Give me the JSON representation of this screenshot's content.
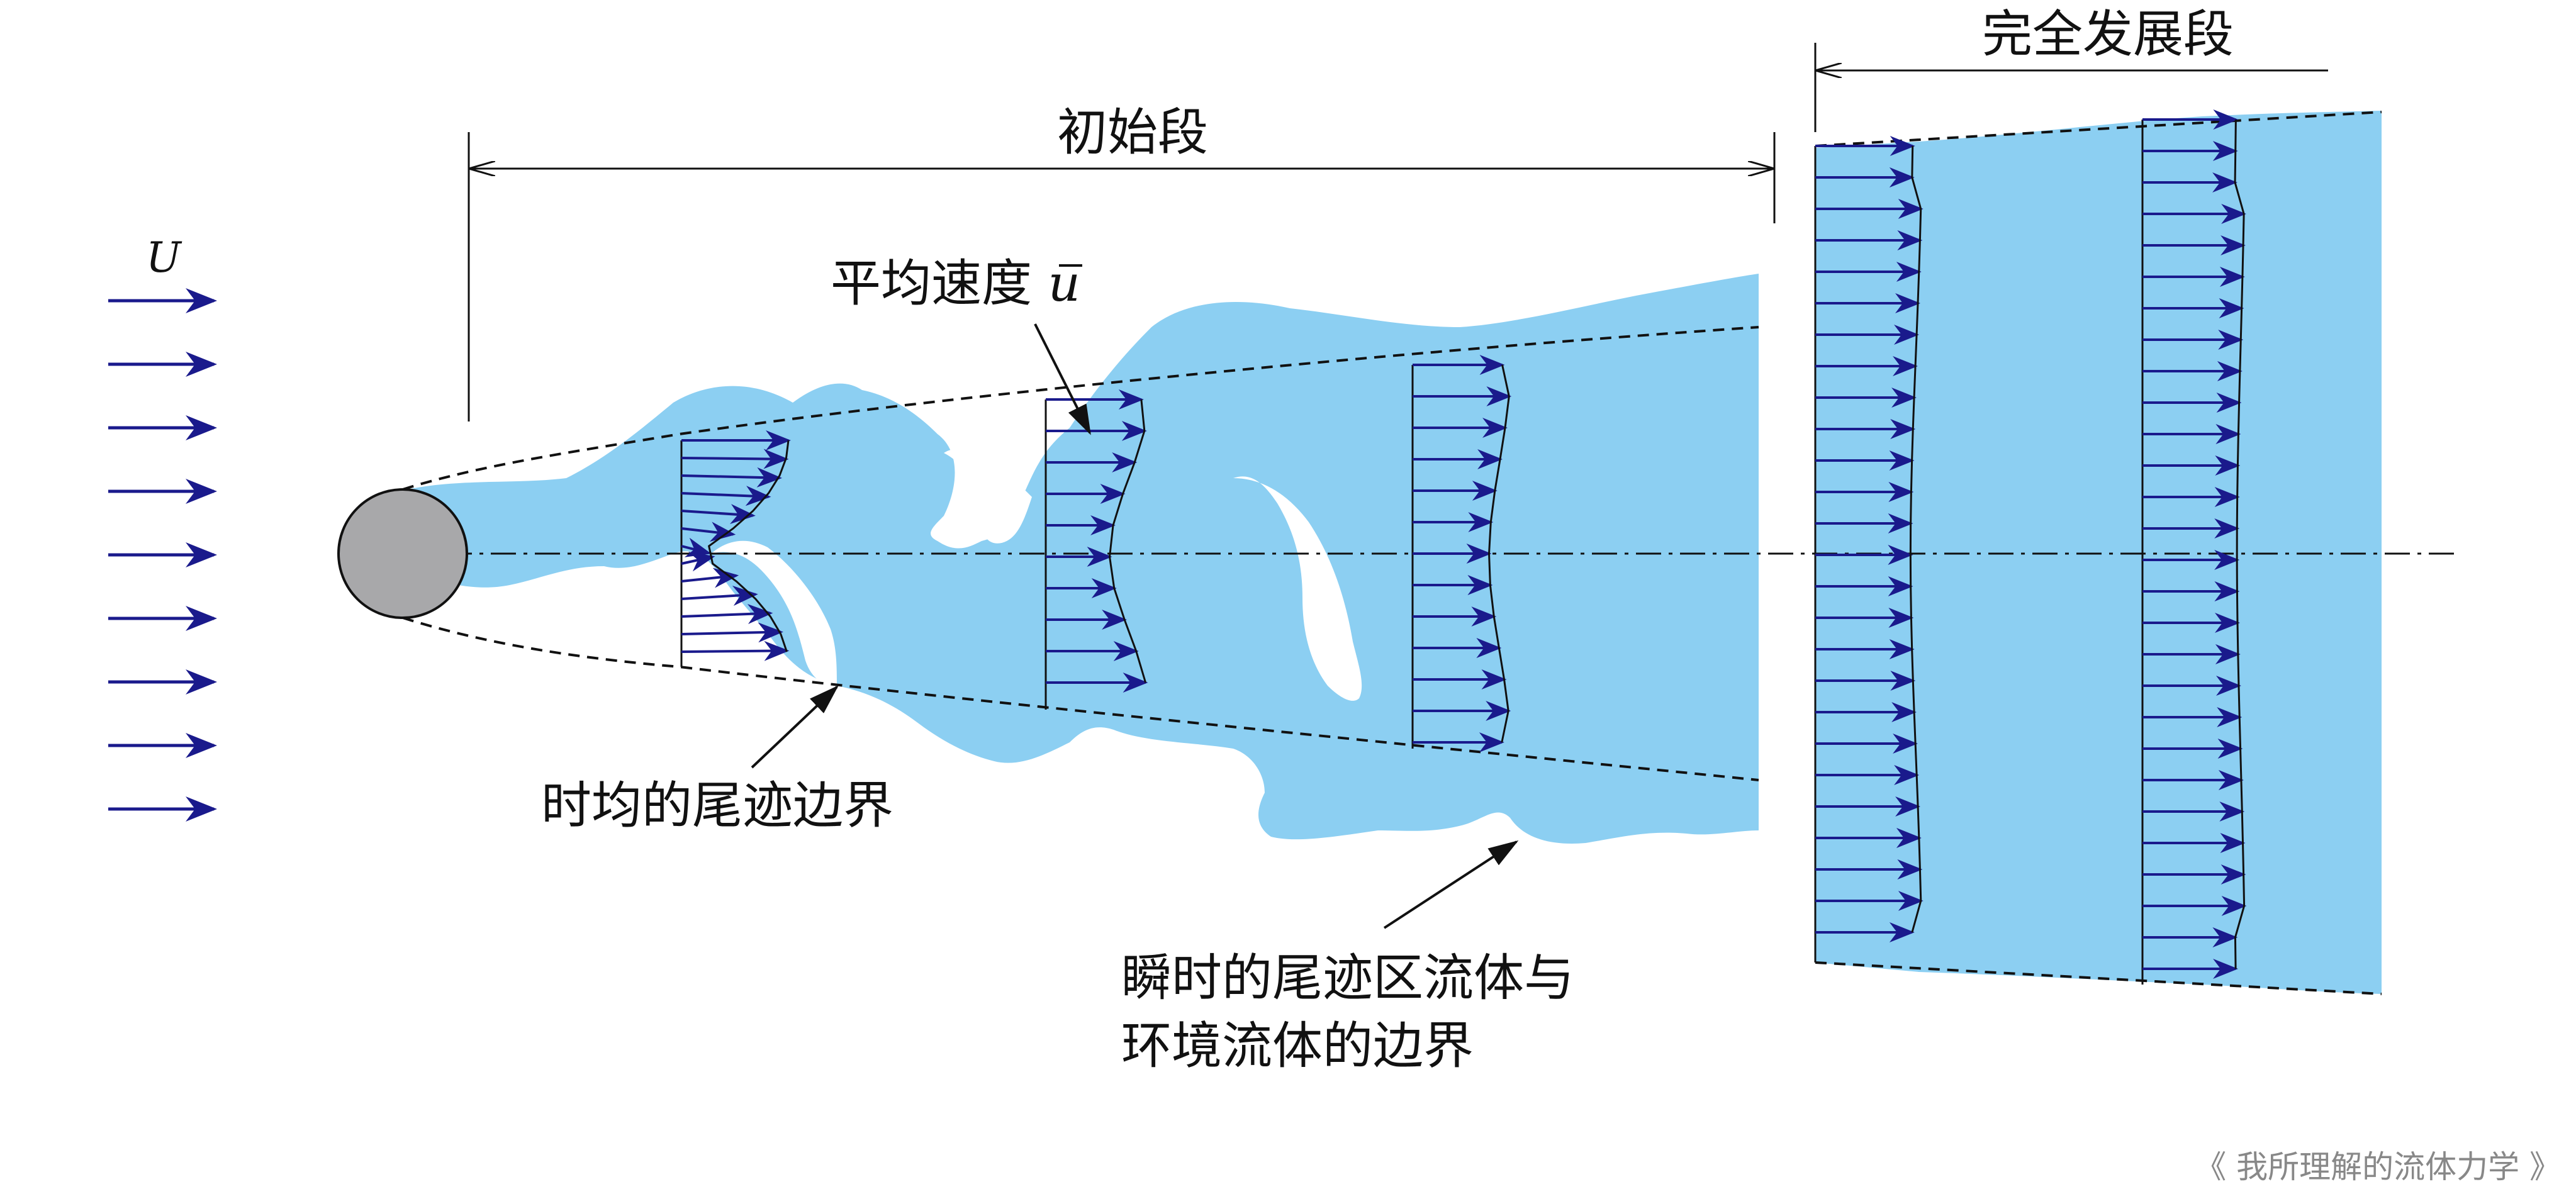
{
  "labels": {
    "free_stream": "U",
    "initial_section": "初始段",
    "developed_section": "完全发展段",
    "mean_velocity_prefix": "平均速度 ",
    "mean_velocity_symbol": "u",
    "time_avg_boundary": "时均的尾迹边界",
    "instant_boundary_line1": "瞬时的尾迹区流体与",
    "instant_boundary_line2": "环境流体的边界",
    "watermark": "《 我所理解的流体力学 》"
  },
  "colors": {
    "wake_fill": "#8ccff2",
    "arrow": "#1a1a8c",
    "cylinder": "#a8a8aa",
    "line": "#111111"
  }
}
